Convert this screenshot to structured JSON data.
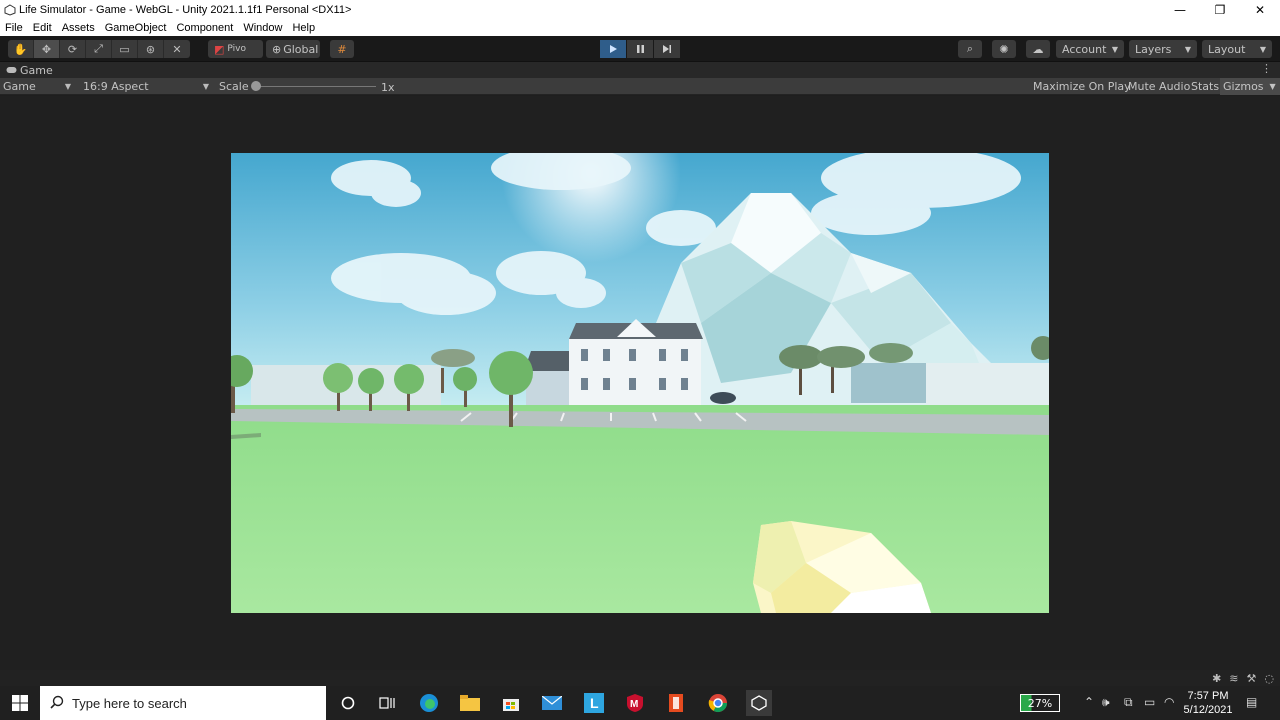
{
  "window": {
    "title": "Life Simulator - Game - WebGL - Unity 2021.1.1f1 Personal <DX11>",
    "minimize": "—",
    "restore": "❐",
    "close": "✕"
  },
  "menu": [
    "File",
    "Edit",
    "Assets",
    "GameObject",
    "Component",
    "Window",
    "Help"
  ],
  "toolbar": {
    "pivot_label": "Pivo",
    "global_label": "Global",
    "account_label": "Account",
    "layers_label": "Layers",
    "layout_label": "Layout"
  },
  "game_tab": {
    "tab_label": "Game",
    "display_label": "Game",
    "aspect_label": "16:9 Aspect",
    "scale_label": "Scale",
    "scale_value": "1x",
    "maximize_label": "Maximize On Play",
    "mute_label": "Mute Audio",
    "stats_label": "Stats",
    "gizmos_label": "Gizmos"
  },
  "taskbar": {
    "search_placeholder": "Type here to search",
    "battery": "27%",
    "time": "7:57 PM",
    "date": "5/12/2021"
  },
  "colors": {
    "sky_top": "#5fb8d8",
    "grass": "#a3e39a",
    "play_active": "#2f5d8a"
  }
}
